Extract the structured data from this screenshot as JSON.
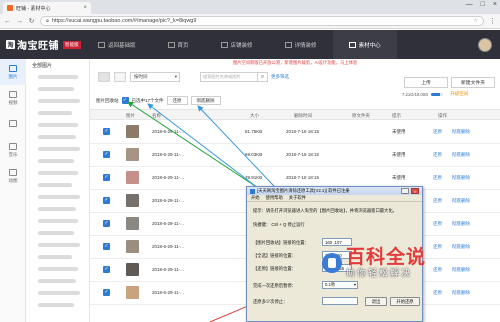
{
  "browser": {
    "tab_title": "旺铺 - 素材中心",
    "url": "https://sucai.wangpu.taobao.com/#/manage/pic?_k=8iqwg9",
    "url_scheme": "https://",
    "url_host": "sucai.wangpu.taobao.com",
    "url_path": "/#/manage/pic?_k=8iqwg9"
  },
  "header": {
    "logo_text": "淘宝旺铺",
    "logo_mark": "淘",
    "badge": "智能版",
    "nav": [
      {
        "label": "返回基础版",
        "active": false
      },
      {
        "label": "首页",
        "active": false
      },
      {
        "label": "店铺装修",
        "active": false
      },
      {
        "label": "详情装修",
        "active": false
      },
      {
        "label": "素材中心",
        "active": true
      }
    ]
  },
  "left_nav": [
    {
      "label": "图片",
      "active": true
    },
    {
      "label": "视频",
      "active": false
    },
    {
      "label": "",
      "active": false
    },
    {
      "label": "音乐",
      "active": false
    },
    {
      "label": "动图",
      "active": false
    }
  ],
  "folders": {
    "title": "全部图片"
  },
  "main": {
    "notice": "图片空间新版已开放公测，新增图片裁剪，AI设计功能，马上体验",
    "sort_label": "按时间",
    "search_placeholder": "搜索图片名称或图片",
    "more_filter": "更多筛选",
    "upload_label": "上传",
    "new_folder_label": "新建文件夹",
    "storage_text": "7.21G/10.00G",
    "storage_fraction": 0.72,
    "upgrade_label": "升级空间",
    "recycle_label": "图片回收站",
    "selected_text": "已选中17个文件",
    "restore_label": "还原",
    "delete_label": "彻底删除",
    "columns": [
      "图片",
      "名称",
      "大小",
      "删除时间",
      "原文件夹",
      "提示",
      "操作"
    ],
    "rows": [
      {
        "name": "2018-6-29-11-...",
        "size": "81.75KB",
        "time": "2018-7-18 18:15",
        "folder": "",
        "status": "未使用",
        "restore": "还原",
        "delete": "彻底删除",
        "thumb": "#8d7b6a"
      },
      {
        "name": "2018-6-29-11-...",
        "size": "69.03KB",
        "time": "2018-7-18 18:15",
        "folder": "",
        "status": "未使用",
        "restore": "还原",
        "delete": "彻底删除",
        "thumb": "#a69484"
      },
      {
        "name": "2018-6-29-11-...",
        "size": "39.91KB",
        "time": "2018-7-18 18:15",
        "folder": "",
        "status": "未使用",
        "restore": "还原",
        "delete": "彻底删除",
        "thumb": "#c58f8a"
      },
      {
        "name": "2018-6-29-11-...",
        "size": "",
        "time": "",
        "folder": "",
        "status": "",
        "restore": "还原",
        "delete": "彻底删除",
        "thumb": "#77706a"
      },
      {
        "name": "2018-6-29-11-...",
        "size": "",
        "time": "",
        "folder": "",
        "status": "",
        "restore": "还原",
        "delete": "彻底删除",
        "thumb": "#8b8782"
      },
      {
        "name": "2018-6-29-11-...",
        "size": "",
        "time": "",
        "folder": "",
        "status": "",
        "restore": "还原",
        "delete": "彻底删除",
        "thumb": "#9a8e80"
      },
      {
        "name": "2018-6-29-11-...",
        "size": "",
        "time": "",
        "folder": "",
        "status": "",
        "restore": "还原",
        "delete": "彻底删除",
        "thumb": "#5f5a55"
      },
      {
        "name": "2018-6-29-11-...",
        "size": "",
        "time": "",
        "folder": "",
        "status": "",
        "restore": "还原",
        "delete": "彻底删除",
        "thumb": "#c9a37e"
      }
    ]
  },
  "dialog": {
    "title": "[天天网淘宝图片清除还原工具(V2.1)] 软件已注册",
    "menu": [
      "开始",
      "使用帮助",
      "关于软件"
    ],
    "hint": "提示：请先打开浏览器进入淘宝的【图片回收站】，并将浏览器窗口最大化。",
    "shortcut": "快捷键：  Ctrl + Q 停止运行",
    "fields": [
      {
        "label": "【图片回收站】链接的位置：",
        "value": "160 ,107"
      },
      {
        "label": "【全选】链接的位置：",
        "value": "141 ,290"
      },
      {
        "label": "【还原】链接的位置：",
        "value": "1006 ,255"
      }
    ],
    "interval_label": "完成一次还原后暂停：",
    "interval_value": "0.1秒",
    "loop_label": "还原多少次停止：",
    "loop_value": "",
    "buttons": [
      "退出",
      "开始还原"
    ]
  },
  "watermark": {
    "title": "百科全说",
    "subtitle": "助你轻松解决"
  },
  "colors": {
    "accent": "#2d7bd5",
    "header_bg": "#2f3039",
    "warning": "#e4393c",
    "annot_green": "#1fa33a",
    "annot_blue": "#3a9ad9",
    "annot_red": "#e23b3b"
  }
}
